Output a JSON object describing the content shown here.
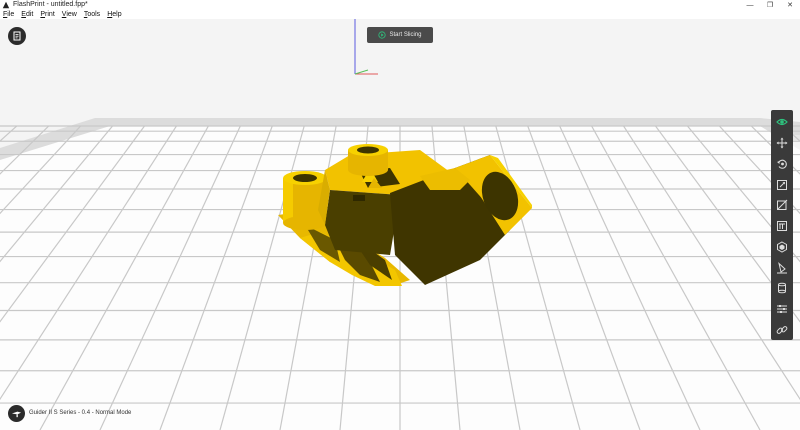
{
  "window": {
    "title": "FlashPrint - untitled.fpp*",
    "controls": [
      "—",
      "❐",
      "✕"
    ]
  },
  "menu": {
    "items": [
      {
        "key": "F",
        "rest": "ile"
      },
      {
        "key": "E",
        "rest": "dit"
      },
      {
        "key": "P",
        "rest": "rint"
      },
      {
        "key": "V",
        "rest": "iew"
      },
      {
        "key": "T",
        "rest": "ools"
      },
      {
        "key": "H",
        "rest": "elp"
      }
    ]
  },
  "toolbar": {
    "start_slicing_label": "Start Slicing"
  },
  "side_tools": [
    {
      "name": "view-icon"
    },
    {
      "name": "move-icon"
    },
    {
      "name": "rotate-icon"
    },
    {
      "name": "scale-icon"
    },
    {
      "name": "cut-icon"
    },
    {
      "name": "support-icon"
    },
    {
      "name": "shell-icon"
    },
    {
      "name": "lay-flat-icon"
    },
    {
      "name": "extruder-icon"
    },
    {
      "name": "settings-icon"
    },
    {
      "name": "link-icon"
    }
  ],
  "status": {
    "printer_mode": "Guider II S Series - 0.4 - Normal Mode"
  },
  "colors": {
    "model": "#f2c200",
    "model_shadow": "#3d3400",
    "accent": "#2ec27e",
    "toolbar_bg": "#3a3a3a"
  }
}
